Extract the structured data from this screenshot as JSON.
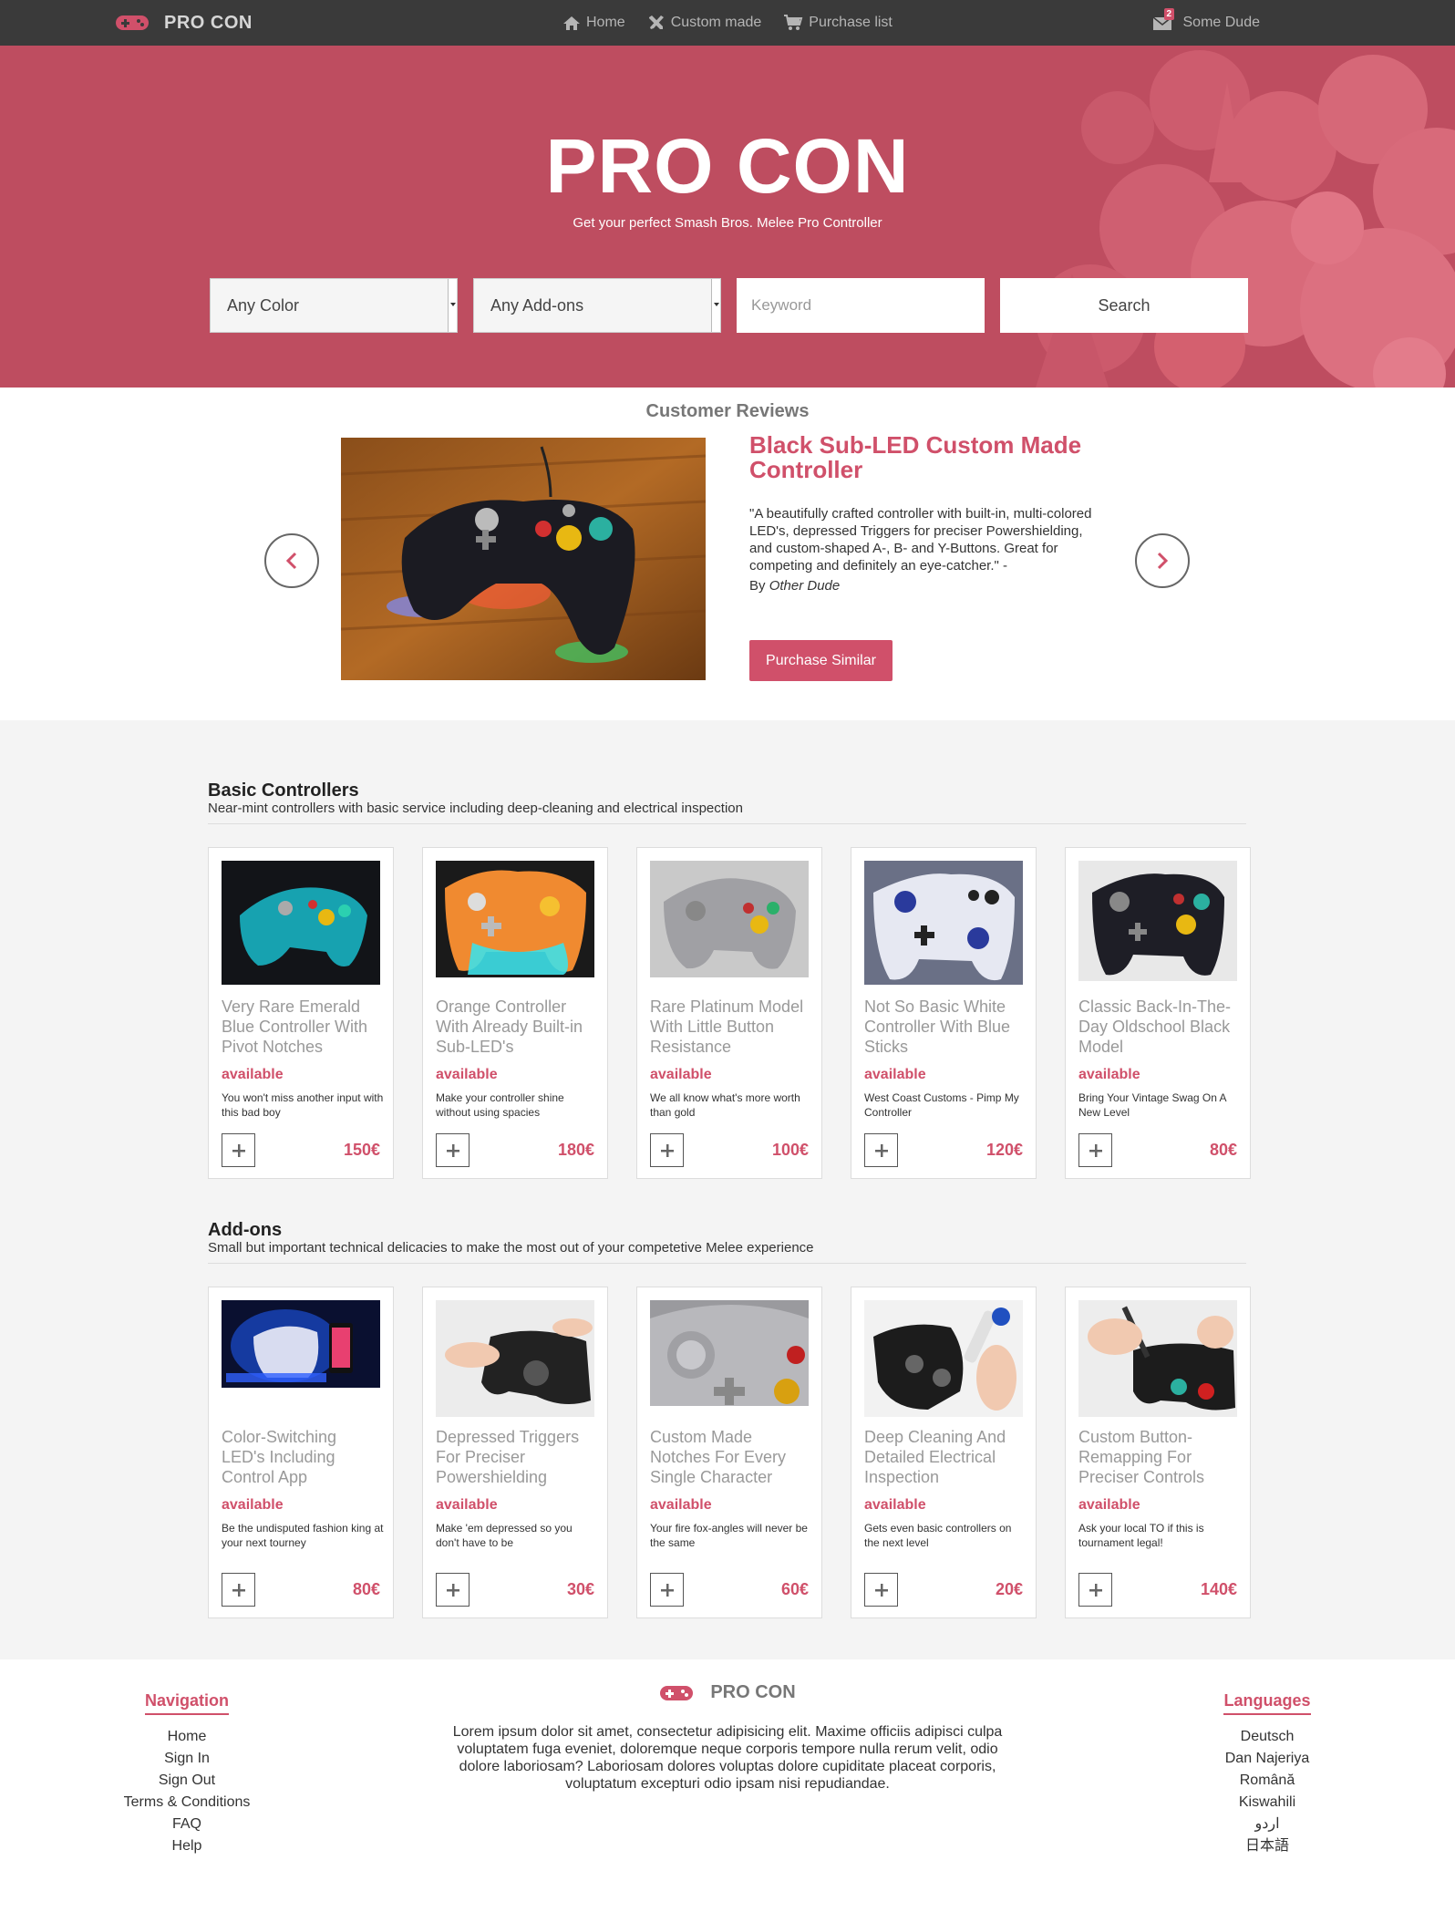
{
  "navbar": {
    "brand": "PRO CON",
    "links": [
      {
        "label": "Home",
        "icon": "home-icon"
      },
      {
        "label": "Custom made",
        "icon": "wrench-icon"
      },
      {
        "label": "Purchase list",
        "icon": "cart-icon"
      }
    ],
    "mail_count": "2",
    "user_name": "Some Dude"
  },
  "hero": {
    "title": "PRO CON",
    "subtitle": "Get your perfect Smash Bros. Melee Pro Controller",
    "color_select": "Any Color",
    "addons_select": "Any Add-ons",
    "keyword_placeholder": "Keyword",
    "search_label": "Search"
  },
  "reviews": {
    "section_title": "Customer Reviews",
    "heading": "Black Sub-LED Custom Made Controller",
    "quote": "\"A beautifully crafted controller with built-in, multi-colored LED's, depressed Triggers for preciser Powershielding, and custom-shaped A-, B- and Y-Buttons. Great for competing and definitely an eye-catcher.\" -",
    "by_label": "By",
    "author": "Other Dude",
    "button": "Purchase Similar"
  },
  "basic": {
    "title": "Basic Controllers",
    "description": "Near-mint controllers with basic service including deep-cleaning and electrical inspection",
    "items": [
      {
        "name": "Very Rare Emerald Blue Controller With Pivot Notches",
        "status": "available",
        "desc": "You won't miss another input with this bad boy",
        "price": "150€"
      },
      {
        "name": "Orange Controller With Already Built-in Sub-LED's",
        "status": "available",
        "desc": "Make your controller shine without using spacies",
        "price": "180€"
      },
      {
        "name": "Rare Platinum Model With Little Button Resistance",
        "status": "available",
        "desc": "We all know what's more worth than gold",
        "price": "100€"
      },
      {
        "name": "Not So Basic White Controller With Blue Sticks",
        "status": "available",
        "desc": "West Coast Customs - Pimp My Controller",
        "price": "120€"
      },
      {
        "name": "Classic Back-In-The-Day Oldschool Black Model",
        "status": "available",
        "desc": "Bring Your Vintage Swag On A New Level",
        "price": "80€"
      }
    ]
  },
  "addons": {
    "title": "Add-ons",
    "description": "Small but important technical delicacies to make the most out of your competetive Melee experience",
    "items": [
      {
        "name": "Color-Switching LED's Including Control App",
        "status": "available",
        "desc": "Be the undisputed fashion king at your next tourney",
        "price": "80€"
      },
      {
        "name": "Depressed Triggers For Preciser Powershielding",
        "status": "available",
        "desc": "Make 'em depressed so you don't have to be",
        "price": "30€"
      },
      {
        "name": "Custom Made Notches For Every Single Character",
        "status": "available",
        "desc": "Your fire fox-angles will never be the same",
        "price": "60€"
      },
      {
        "name": "Deep Cleaning And Detailed Electrical Inspection",
        "status": "available",
        "desc": "Gets even basic controllers on the next level",
        "price": "20€"
      },
      {
        "name": "Custom Button-Remapping For Preciser Controls",
        "status": "available",
        "desc": "Ask your local TO if this is tournament legal!",
        "price": "140€"
      }
    ]
  },
  "footer": {
    "nav_heading": "Navigation",
    "nav_links": [
      "Home",
      "Sign In",
      "Sign Out",
      "Terms & Conditions",
      "FAQ",
      "Help"
    ],
    "brand": "PRO CON",
    "lorem": "Lorem ipsum dolor sit amet, consectetur adipisicing elit. Maxime officiis adipisci culpa voluptatem fuga eveniet, doloremque neque corporis tempore nulla rerum velit, odio dolore laboriosam? Laboriosam dolores voluptas dolore cupiditate placeat corporis, voluptatum excepturi odio ipsam nisi repudiandae.",
    "lang_heading": "Languages",
    "languages": [
      "Deutsch",
      "Dan Najeriya",
      "Română",
      "Kiswahili",
      "اردو",
      "日本語"
    ]
  },
  "colors": {
    "accent": "#d0506a",
    "hero_bg": "#be4d60",
    "navbar_bg": "#3a3a3a"
  }
}
